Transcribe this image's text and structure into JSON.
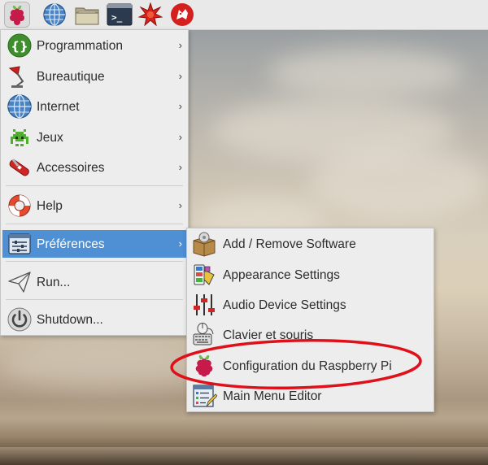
{
  "main_menu": {
    "items": [
      {
        "label": "Programmation",
        "icon": "programming-icon",
        "has_submenu": true
      },
      {
        "label": "Bureautique",
        "icon": "office-lamp-icon",
        "has_submenu": true
      },
      {
        "label": "Internet",
        "icon": "globe-icon",
        "has_submenu": true
      },
      {
        "label": "Jeux",
        "icon": "space-invader-icon",
        "has_submenu": true
      },
      {
        "label": "Accessoires",
        "icon": "swiss-knife-icon",
        "has_submenu": true
      },
      {
        "label": "Help",
        "icon": "lifebuoy-icon",
        "has_submenu": true
      },
      {
        "label": "Préférences",
        "icon": "preferences-panel-icon",
        "has_submenu": true,
        "active": true
      },
      {
        "label": "Run...",
        "icon": "paper-plane-icon",
        "has_submenu": false
      },
      {
        "label": "Shutdown...",
        "icon": "power-icon",
        "has_submenu": false
      }
    ],
    "arrow_glyph": "›"
  },
  "submenu": {
    "items": [
      {
        "label": "Add / Remove Software",
        "icon": "package-icon"
      },
      {
        "label": "Appearance Settings",
        "icon": "color-swatches-icon"
      },
      {
        "label": "Audio Device Settings",
        "icon": "mixer-sliders-icon"
      },
      {
        "label": "Clavier et souris",
        "icon": "keyboard-mouse-icon"
      },
      {
        "label": "Configuration du Raspberry Pi",
        "icon": "raspberry-icon",
        "highlighted": true
      },
      {
        "label": "Main Menu Editor",
        "icon": "menu-editor-icon"
      }
    ]
  },
  "taskbar": {
    "icons": [
      "raspberry-menu-icon",
      "web-browser-globe-icon",
      "file-manager-folder-icon",
      "terminal-icon",
      "math-star-icon",
      "wolfram-icon"
    ],
    "terminal_glyph": ">_"
  },
  "colors": {
    "menu_active": "#4f8fd4",
    "annotation": "#e0101a",
    "raspberry": "#c51a4a",
    "leaf": "#6cc04a"
  }
}
